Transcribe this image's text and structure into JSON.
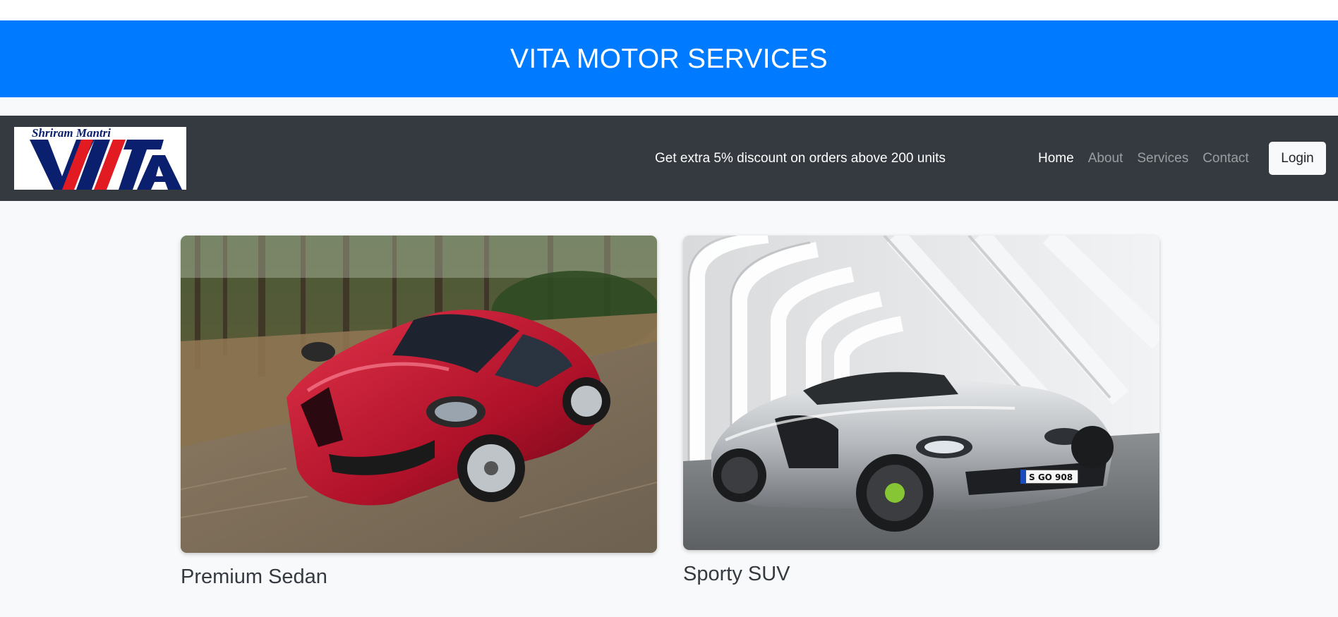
{
  "header": {
    "title": "VITA MOTOR SERVICES"
  },
  "navbar": {
    "logo": {
      "top_text": "Shriram Mantri",
      "main_text": "VITA"
    },
    "promo_text": "Get extra 5% discount on orders above 200 units",
    "links": [
      {
        "label": "Home"
      },
      {
        "label": "About"
      },
      {
        "label": "Services"
      },
      {
        "label": "Contact"
      }
    ],
    "login_label": "Login"
  },
  "cards": [
    {
      "title": "Premium Sedan",
      "image": "red-sports-car-photo"
    },
    {
      "title": "Sporty SUV",
      "image": "silver-sports-car-photo",
      "plate_text": "S GO 908"
    }
  ],
  "colors": {
    "banner": "#007bff",
    "navbar": "#343a40",
    "background": "#f8f9fa",
    "logo_red": "#e21b23",
    "logo_navy": "#0a1f6e"
  }
}
